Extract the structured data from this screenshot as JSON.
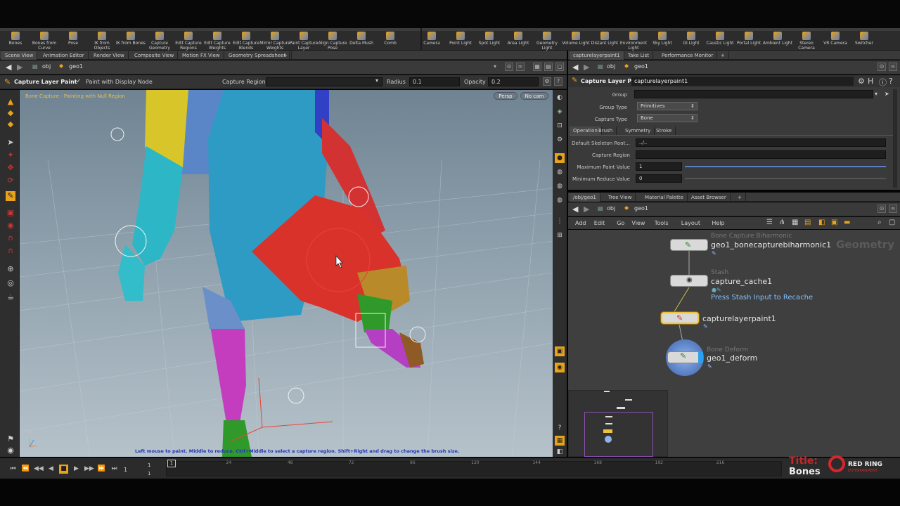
{
  "shelf_left": [
    {
      "label": "Bones",
      "icon": "bone-icon"
    },
    {
      "label": "Bones from Curve",
      "icon": "bone-curve-icon"
    },
    {
      "label": "Pose",
      "icon": "pose-icon"
    },
    {
      "label": "IK from Objects",
      "icon": "ik-objects-icon"
    },
    {
      "label": "IK from Bones",
      "icon": "ik-bones-icon"
    },
    {
      "label": "Capture Geometry",
      "icon": "capture-geometry-icon"
    },
    {
      "label": "Edit Capture Regions",
      "icon": "edit-capture-regions-icon"
    },
    {
      "label": "Edit Capture Weights",
      "icon": "edit-capture-weights-icon"
    },
    {
      "label": "Edit Capture Blends",
      "icon": "edit-capture-blends-icon"
    },
    {
      "label": "Mirror Capture Weights",
      "icon": "mirror-capture-icon"
    },
    {
      "label": "Paint Capture Layer",
      "icon": "paint-capture-icon"
    },
    {
      "label": "Align Capture Pose",
      "icon": "align-capture-icon"
    },
    {
      "label": "Delta Mush",
      "icon": "delta-mush-icon"
    },
    {
      "label": "Comb",
      "icon": "comb-icon"
    }
  ],
  "shelf_right": [
    {
      "label": "Camera",
      "icon": "camera-icon"
    },
    {
      "label": "Point Light",
      "icon": "point-light-icon"
    },
    {
      "label": "Spot Light",
      "icon": "spot-light-icon"
    },
    {
      "label": "Area Light",
      "icon": "area-light-icon"
    },
    {
      "label": "Geometry Light",
      "icon": "geometry-light-icon"
    },
    {
      "label": "Volume Light",
      "icon": "volume-light-icon"
    },
    {
      "label": "Distant Light",
      "icon": "distant-light-icon"
    },
    {
      "label": "Environment Light",
      "icon": "environment-light-icon"
    },
    {
      "label": "Sky Light",
      "icon": "sky-light-icon"
    },
    {
      "label": "GI Light",
      "icon": "gi-light-icon"
    },
    {
      "label": "Caustic Light",
      "icon": "caustic-light-icon"
    },
    {
      "label": "Portal Light",
      "icon": "portal-light-icon"
    },
    {
      "label": "Ambient Light",
      "icon": "ambient-light-icon"
    },
    {
      "label": "Stereo Camera",
      "icon": "stereo-camera-icon"
    },
    {
      "label": "VR Camera",
      "icon": "vr-camera-icon"
    },
    {
      "label": "Switcher",
      "icon": "switcher-icon"
    }
  ],
  "left_tabs": [
    "Scene View",
    "Animation Editor",
    "Render View",
    "Composite View",
    "Motion FX View",
    "Geometry Spreadsheet"
  ],
  "right_top_tabs": [
    "capturelayerpaint1",
    "Take List",
    "Performance Monitor"
  ],
  "right_bottom_tabs": [
    "/obj/geo1",
    "Tree View",
    "Material Palette",
    "Asset Browser"
  ],
  "path": {
    "obj": "obj",
    "geo": "geo1"
  },
  "tool_bar": {
    "tool_name": "Capture Layer Paint",
    "display_toggle": "Paint with Display Node",
    "capture_region_label": "Capture Region",
    "radius_label": "Radius",
    "radius_value": "0.1",
    "opacity_label": "Opacity",
    "opacity_value": "0.2"
  },
  "viewport": {
    "status_text": "Bone Capture - Painting with Null Region",
    "persp": "Persp",
    "cam": "No cam",
    "hint": "Left mouse to paint.  Middle to reduce.  Ctrl+Middle to select a capture region.  Shift+Right and drag to change the brush size."
  },
  "params": {
    "header_type": "Capture Layer Paint",
    "node_name": "capturelayerpaint1",
    "group_label": "Group",
    "group_value": "",
    "group_type_label": "Group Type",
    "group_type_value": "Primitives",
    "capture_type_label": "Capture Type",
    "capture_type_value": "Bone",
    "tabs": [
      "Operation",
      "Brush",
      "Symmetry",
      "Stroke"
    ],
    "default_root_label": "Default Skeleton Root...",
    "default_root_value": "../..",
    "capture_region_label": "Capture Region",
    "capture_region_value": "",
    "max_paint_label": "Maximum Paint Value",
    "max_paint_value": "1",
    "min_reduce_label": "Minimum Reduce Value",
    "min_reduce_value": "0"
  },
  "network_menu": [
    "Add",
    "Edit",
    "Go",
    "View",
    "Tools",
    "Layout",
    "Help"
  ],
  "network_context": "Geometry",
  "nodes": [
    {
      "type": "Bone Capture Biharmonic",
      "name": "geo1_bonecapturebiharmonic1"
    },
    {
      "type": "Stash",
      "name": "capture_cache1",
      "note": "Press Stash Input to Recache"
    },
    {
      "type": "",
      "name": "capturelayerpaint1"
    },
    {
      "type": "Bone Deform",
      "name": "geo1_deform"
    }
  ],
  "timeline": {
    "frame": "1",
    "start": "1",
    "end": "1",
    "ticks": [
      "24",
      "48",
      "72",
      "96",
      "120",
      "144",
      "168",
      "192",
      "216"
    ],
    "current": "1"
  },
  "watermark": {
    "title_label": "Title:",
    "title_value": "Bones",
    "brand": "RED RING",
    "brand_sub": "ENTERTAINMENT"
  },
  "colors": {
    "accent": "#e8a21c",
    "selected_node": "#f0c23a",
    "brand_red": "#d6262e"
  }
}
